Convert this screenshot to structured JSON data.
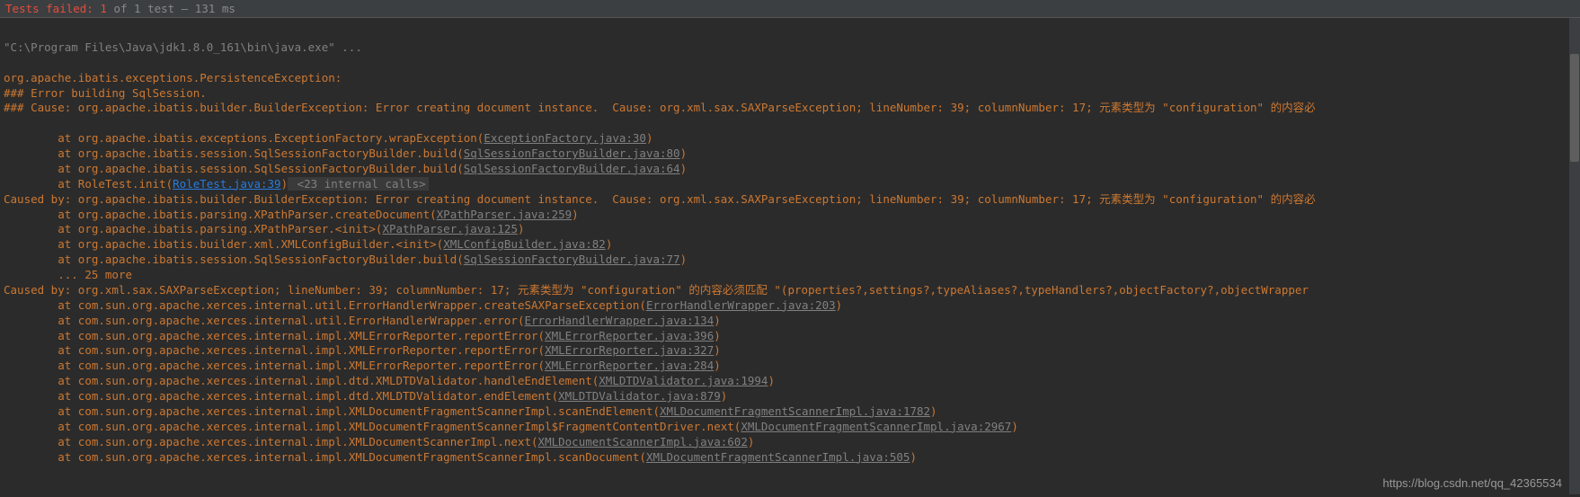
{
  "header": {
    "tests_failed_label": "Tests failed:",
    "tests_count": "1",
    "of_label": "of",
    "tests_total": "1",
    "test_label": "test",
    "duration": "– 131 ms"
  },
  "cmd_line": "\"C:\\Program Files\\Java\\jdk1.8.0_161\\bin\\java.exe\" ...",
  "exception_header": "org.apache.ibatis.exceptions.PersistenceException:",
  "error_building": "### Error building SqlSession.",
  "cause_line": "### Cause: org.apache.ibatis.builder.BuilderException: Error creating document instance.  Cause: org.xml.sax.SAXParseException; lineNumber: 39; columnNumber: 17; 元素类型为 \"configuration\" 的内容必",
  "stack1": {
    "prefix": "\tat org.apache.ibatis.exceptions.ExceptionFactory.wrapException(",
    "link": "ExceptionFactory.java:30",
    "suffix": ")"
  },
  "stack2": {
    "prefix": "\tat org.apache.ibatis.session.SqlSessionFactoryBuilder.build(",
    "link": "SqlSessionFactoryBuilder.java:80",
    "suffix": ")"
  },
  "stack3": {
    "prefix": "\tat org.apache.ibatis.session.SqlSessionFactoryBuilder.build(",
    "link": "SqlSessionFactoryBuilder.java:64",
    "suffix": ")"
  },
  "stack4": {
    "prefix": "\tat RoleTest.init(",
    "link": "RoleTest.java:39",
    "suffix": ")",
    "internal": " <23 internal calls>"
  },
  "caused_by1": "Caused by: org.apache.ibatis.builder.BuilderException: Error creating document instance.  Cause: org.xml.sax.SAXParseException; lineNumber: 39; columnNumber: 17; 元素类型为 \"configuration\" 的内容必",
  "stack5": {
    "prefix": "\tat org.apache.ibatis.parsing.XPathParser.createDocument(",
    "link": "XPathParser.java:259",
    "suffix": ")"
  },
  "stack6": {
    "prefix": "\tat org.apache.ibatis.parsing.XPathParser.<init>(",
    "link": "XPathParser.java:125",
    "suffix": ")"
  },
  "stack7": {
    "prefix": "\tat org.apache.ibatis.builder.xml.XMLConfigBuilder.<init>(",
    "link": "XMLConfigBuilder.java:82",
    "suffix": ")"
  },
  "stack8": {
    "prefix": "\tat org.apache.ibatis.session.SqlSessionFactoryBuilder.build(",
    "link": "SqlSessionFactoryBuilder.java:77",
    "suffix": ")"
  },
  "more25": "\t... 25 more",
  "caused_by2": "Caused by: org.xml.sax.SAXParseException; lineNumber: 39; columnNumber: 17; 元素类型为 \"configuration\" 的内容必须匹配 \"(properties?,settings?,typeAliases?,typeHandlers?,objectFactory?,objectWrapper",
  "stack9": {
    "prefix": "\tat com.sun.org.apache.xerces.internal.util.ErrorHandlerWrapper.createSAXParseException(",
    "link": "ErrorHandlerWrapper.java:203",
    "suffix": ")"
  },
  "stack10": {
    "prefix": "\tat com.sun.org.apache.xerces.internal.util.ErrorHandlerWrapper.error(",
    "link": "ErrorHandlerWrapper.java:134",
    "suffix": ")"
  },
  "stack11": {
    "prefix": "\tat com.sun.org.apache.xerces.internal.impl.XMLErrorReporter.reportError(",
    "link": "XMLErrorReporter.java:396",
    "suffix": ")"
  },
  "stack12": {
    "prefix": "\tat com.sun.org.apache.xerces.internal.impl.XMLErrorReporter.reportError(",
    "link": "XMLErrorReporter.java:327",
    "suffix": ")"
  },
  "stack13": {
    "prefix": "\tat com.sun.org.apache.xerces.internal.impl.XMLErrorReporter.reportError(",
    "link": "XMLErrorReporter.java:284",
    "suffix": ")"
  },
  "stack14": {
    "prefix": "\tat com.sun.org.apache.xerces.internal.impl.dtd.XMLDTDValidator.handleEndElement(",
    "link": "XMLDTDValidator.java:1994",
    "suffix": ")"
  },
  "stack15": {
    "prefix": "\tat com.sun.org.apache.xerces.internal.impl.dtd.XMLDTDValidator.endElement(",
    "link": "XMLDTDValidator.java:879",
    "suffix": ")"
  },
  "stack16": {
    "prefix": "\tat com.sun.org.apache.xerces.internal.impl.XMLDocumentFragmentScannerImpl.scanEndElement(",
    "link": "XMLDocumentFragmentScannerImpl.java:1782",
    "suffix": ")"
  },
  "stack17": {
    "prefix": "\tat com.sun.org.apache.xerces.internal.impl.XMLDocumentFragmentScannerImpl$FragmentContentDriver.next(",
    "link": "XMLDocumentFragmentScannerImpl.java:2967",
    "suffix": ")"
  },
  "stack18": {
    "prefix": "\tat com.sun.org.apache.xerces.internal.impl.XMLDocumentScannerImpl.next(",
    "link": "XMLDocumentScannerImpl.java:602",
    "suffix": ")"
  },
  "stack19": {
    "prefix": "\tat com.sun.org.apache.xerces.internal.impl.XMLDocumentFragmentScannerImpl.scanDocument(",
    "link": "XMLDocumentFragmentScannerImpl.java:505",
    "suffix": ")"
  },
  "watermark": "https://blog.csdn.net/qq_42365534"
}
